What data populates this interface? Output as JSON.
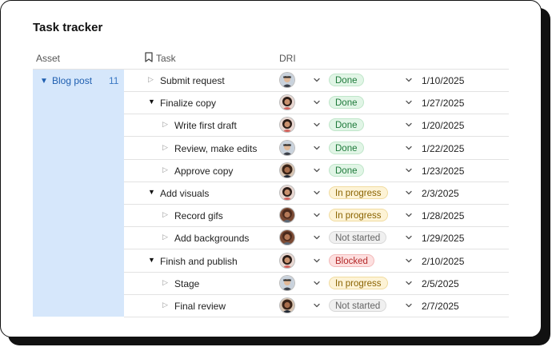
{
  "title": "Task tracker",
  "columns": {
    "asset": "Asset",
    "task": "Task",
    "dri": "DRI"
  },
  "asset": {
    "label": "Blog post",
    "count": "11"
  },
  "status_styles": {
    "Done": {
      "bg": "#e1f5e6",
      "border": "#bfe6c9",
      "fg": "#1e7a3a"
    },
    "In progress": {
      "bg": "#fdf3d6",
      "border": "#f1dca0",
      "fg": "#8a6300"
    },
    "Not started": {
      "bg": "#f0f0f0",
      "border": "#d8d8d8",
      "fg": "#666666"
    },
    "Blocked": {
      "bg": "#fde0e0",
      "border": "#f3b9b9",
      "fg": "#b42a2a"
    }
  },
  "rows": [
    {
      "task": "Submit request",
      "level": 0,
      "toggle": "closed",
      "dri": "avatar-a",
      "status": "Done",
      "date": "1/10/2025"
    },
    {
      "task": "Finalize copy",
      "level": 0,
      "toggle": "open",
      "dri": "avatar-b",
      "status": "Done",
      "date": "1/27/2025"
    },
    {
      "task": "Write first draft",
      "level": 1,
      "toggle": "closed",
      "dri": "avatar-b",
      "status": "Done",
      "date": "1/20/2025"
    },
    {
      "task": "Review, make edits",
      "level": 1,
      "toggle": "closed",
      "dri": "avatar-a",
      "status": "Done",
      "date": "1/22/2025"
    },
    {
      "task": "Approve copy",
      "level": 1,
      "toggle": "closed",
      "dri": "avatar-c",
      "status": "Done",
      "date": "1/23/2025"
    },
    {
      "task": "Add visuals",
      "level": 0,
      "toggle": "open",
      "dri": "avatar-b",
      "status": "In progress",
      "date": "2/3/2025"
    },
    {
      "task": "Record gifs",
      "level": 1,
      "toggle": "closed",
      "dri": "avatar-d",
      "status": "In progress",
      "date": "1/28/2025"
    },
    {
      "task": "Add backgrounds",
      "level": 1,
      "toggle": "closed",
      "dri": "avatar-d",
      "status": "Not started",
      "date": "1/29/2025"
    },
    {
      "task": "Finish and publish",
      "level": 0,
      "toggle": "open",
      "dri": "avatar-b",
      "status": "Blocked",
      "date": "2/10/2025"
    },
    {
      "task": "Stage",
      "level": 1,
      "toggle": "closed",
      "dri": "avatar-a",
      "status": "In progress",
      "date": "2/5/2025"
    },
    {
      "task": "Final review",
      "level": 1,
      "toggle": "closed",
      "dri": "avatar-c",
      "status": "Not started",
      "date": "2/7/2025"
    }
  ]
}
